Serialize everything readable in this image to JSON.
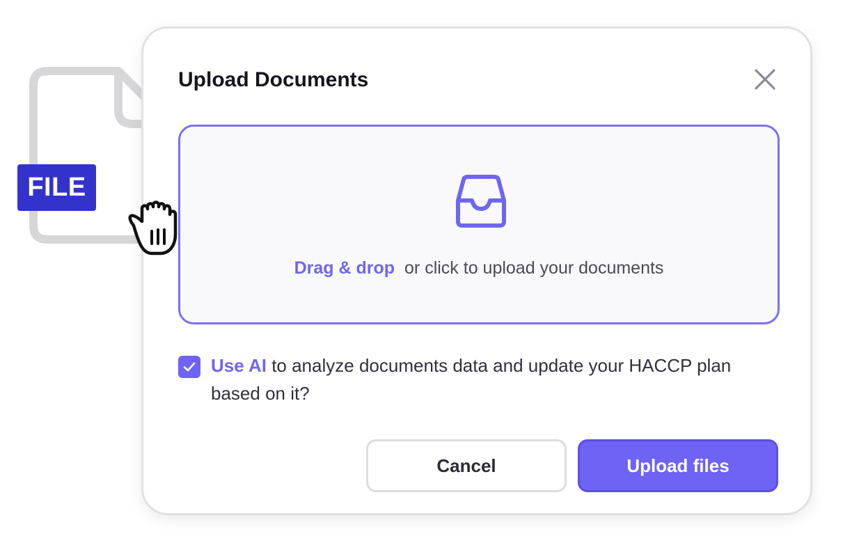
{
  "file_badge": {
    "label": "FILE"
  },
  "dialog": {
    "title": "Upload Documents",
    "close_icon": "close-icon"
  },
  "dropzone": {
    "icon": "inbox-icon",
    "link_text": "Drag & drop",
    "text": "or click to upload your documents"
  },
  "ai_option": {
    "checked": true,
    "highlight": "Use AI",
    "text": " to analyze documents data and update your HACCP plan based on it?"
  },
  "buttons": {
    "cancel": "Cancel",
    "upload": "Upload files"
  },
  "colors": {
    "accent": "#6e63f5",
    "badge": "#3333cc",
    "title": "#16161f"
  },
  "cursor": {
    "icon": "grab-hand-icon"
  }
}
